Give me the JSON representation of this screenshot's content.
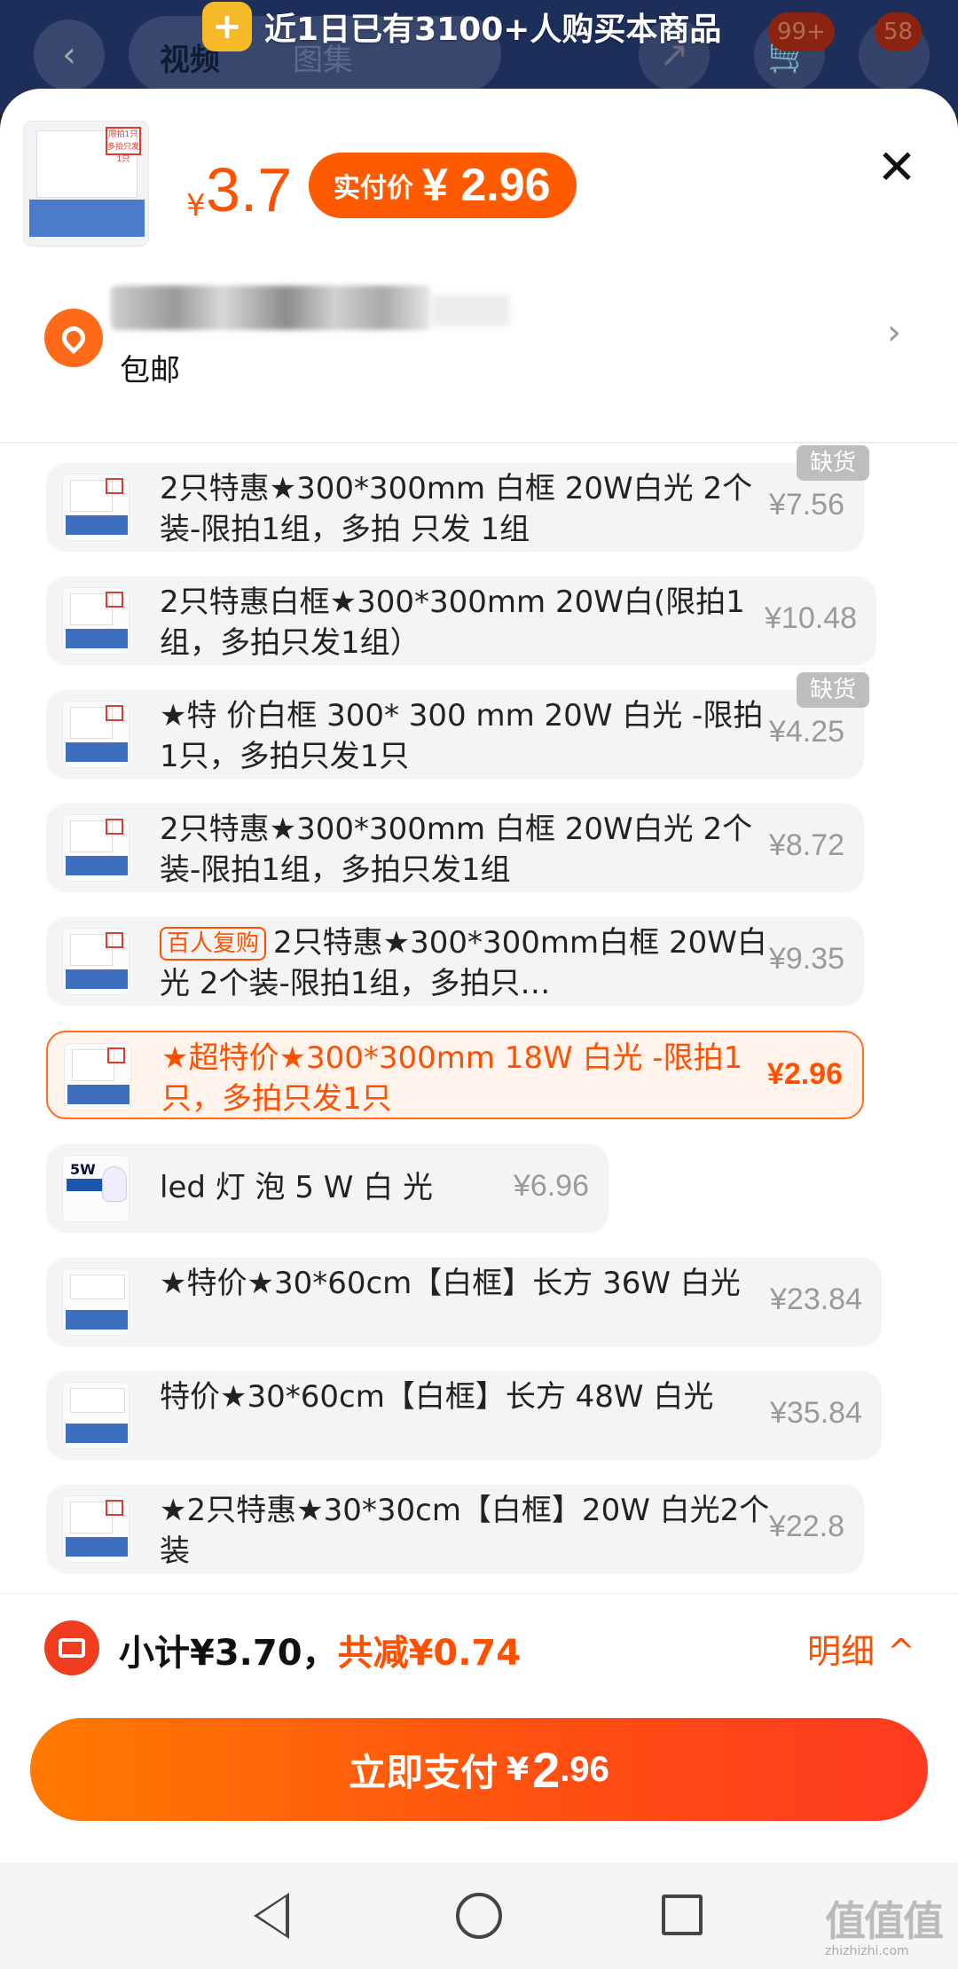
{
  "background": {
    "tab_video": "视频",
    "tab_images": "图集",
    "cart_badge": "99+",
    "more_badge": "58"
  },
  "banner": {
    "text": "近1日已有3100+人购买本商品"
  },
  "header": {
    "yen": "¥",
    "price": "3.7",
    "real_price_label": "实付价",
    "real_price_value": "¥ 2.96",
    "thumb_text": "限拍1只 多拍只发1只"
  },
  "address": {
    "shipping": "包邮"
  },
  "options": [
    {
      "name": "2只特惠★300*300mm 白框 20W白光 2个装-限拍1组，多拍 只发 1组",
      "price": "¥7.56",
      "badge": "缺货",
      "tag": ""
    },
    {
      "name": "2只特惠白框★300*300mm 20W白(限拍1组，多拍只发1组）",
      "price": "¥10.48",
      "badge": "",
      "tag": ""
    },
    {
      "name": "★特 价白框 300* 300 mm 20W 白光 -限拍1只，多拍只发1只",
      "price": "¥4.25",
      "badge": "缺货",
      "tag": ""
    },
    {
      "name": "2只特惠★300*300mm 白框 20W白光 2个装-限拍1组，多拍只发1组",
      "price": "¥8.72",
      "badge": "",
      "tag": ""
    },
    {
      "name": "2只特惠★300*300mm白框 20W白光 2个装-限拍1组，多拍只…",
      "price": "¥9.35",
      "badge": "",
      "tag": "百人复购"
    },
    {
      "name": "★超特价★300*300mm 18W 白光 -限拍1只，多拍只发1只",
      "price": "¥2.96",
      "badge": "",
      "tag": ""
    },
    {
      "name": "led 灯 泡 5 W 白 光",
      "price": "¥6.96",
      "badge": "",
      "tag": "",
      "thumb_label": "5W"
    },
    {
      "name": "★特价★30*60cm【白框】长方 36W 白光",
      "price": "¥23.84",
      "badge": "",
      "tag": ""
    },
    {
      "name": "特价★30*60cm【白框】长方 48W 白光",
      "price": "¥35.84",
      "badge": "",
      "tag": ""
    },
    {
      "name": "★2只特惠★30*30cm【白框】20W 白光2个装",
      "price": "¥22.8",
      "badge": "",
      "tag": ""
    }
  ],
  "footer": {
    "subtotal": "小计¥3.70，",
    "discount": "共减¥0.74",
    "detail_label": "明细",
    "pay_label": "立即支付",
    "pay_yen": "¥",
    "pay_int": "2",
    "pay_dec": ".96"
  },
  "watermark": {
    "logo": "值值值",
    "url": "zhizhizhi.com"
  },
  "colors": {
    "accent": "#ff5000",
    "selected_bg": "#fff3ec",
    "out_of_stock": "#bdbdbd"
  },
  "selected_option_index": 5
}
